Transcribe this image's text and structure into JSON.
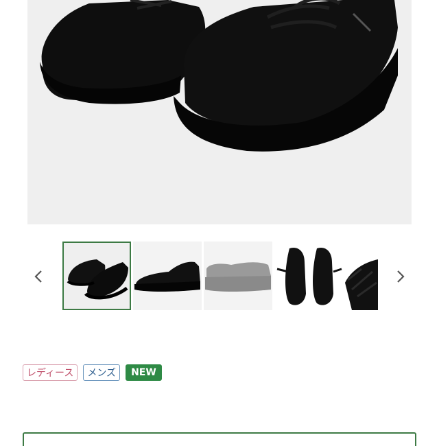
{
  "product": {
    "main_image": "black-knit-sneakers-photo",
    "thumbnails": [
      {
        "name": "thumb-1",
        "subject": "pair-angled",
        "active": true
      },
      {
        "name": "thumb-2",
        "subject": "side-view-black",
        "active": false
      },
      {
        "name": "thumb-3",
        "subject": "side-view-gray",
        "active": false
      },
      {
        "name": "thumb-4",
        "subject": "top-view-pair",
        "active": false
      },
      {
        "name": "thumb-5",
        "subject": "laces-closeup",
        "active": false
      }
    ]
  },
  "carousel": {
    "prev_icon": "chevron-left-icon",
    "next_icon": "chevron-right-icon"
  },
  "tags": {
    "ladies": "レディース",
    "mens": "メンズ",
    "new": "NEW"
  },
  "colors": {
    "active_border": "#3d7a44",
    "ladies": "#c0506b",
    "mens": "#2f5f8f",
    "new_bg": "#2e8a45"
  }
}
